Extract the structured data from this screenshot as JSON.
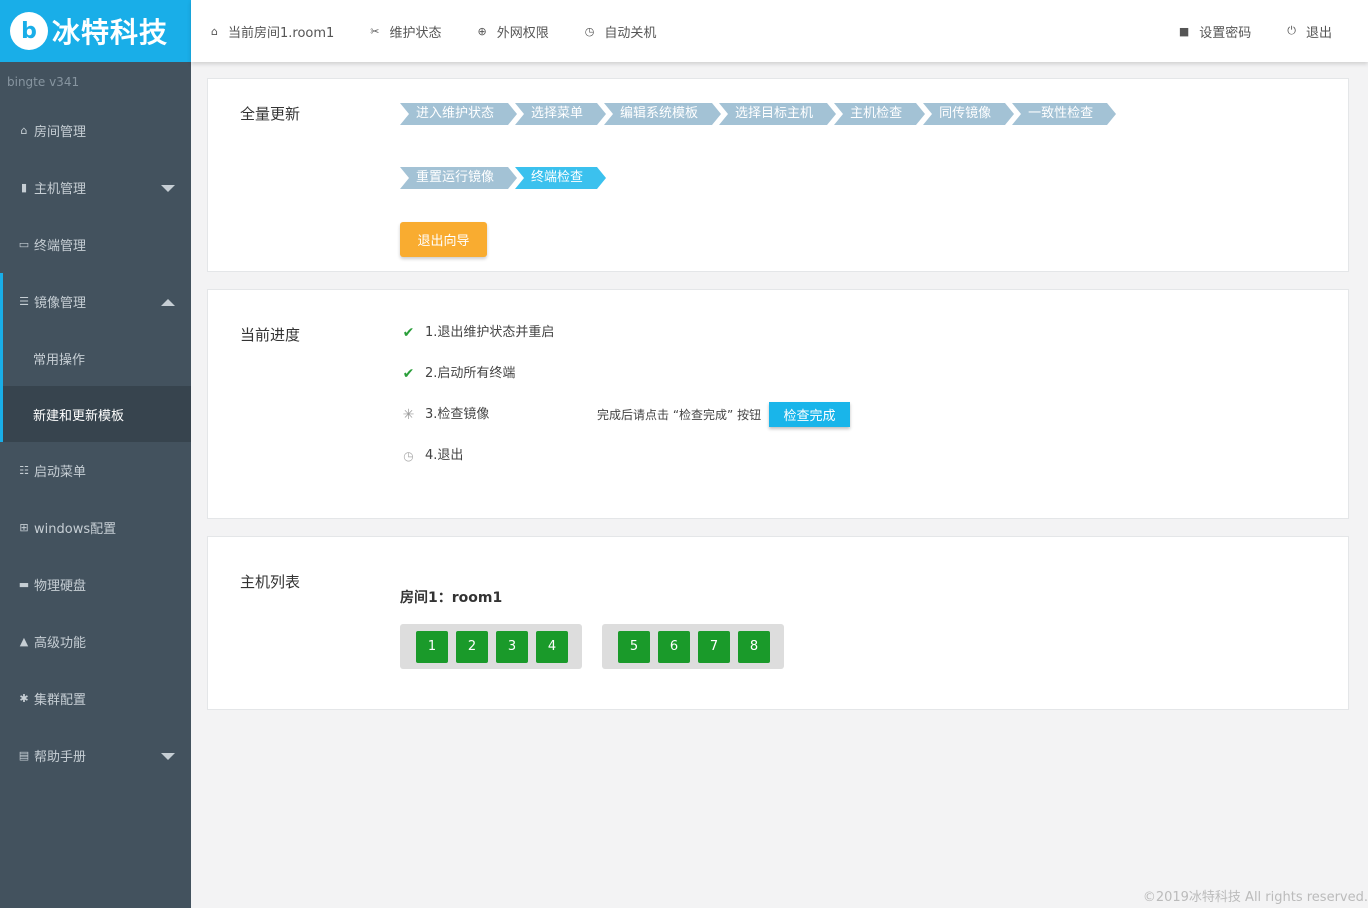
{
  "brand": {
    "logo_letter": "b",
    "name": "冰特科技",
    "version": "bingte  v341"
  },
  "sidebar": {
    "items": [
      {
        "label": "房间管理",
        "icon": "home-icon"
      },
      {
        "label": "主机管理",
        "icon": "server-icon",
        "caret": "down"
      },
      {
        "label": "终端管理",
        "icon": "monitor-icon"
      },
      {
        "label": "镜像管理",
        "icon": "database-icon",
        "caret": "up",
        "open": true
      },
      {
        "label": "启动菜单",
        "icon": "list-icon"
      },
      {
        "label": "windows配置",
        "icon": "windows-icon"
      },
      {
        "label": "物理硬盘",
        "icon": "hdd-icon"
      },
      {
        "label": "高级功能",
        "icon": "warning-icon"
      },
      {
        "label": "集群配置",
        "icon": "gear-icon"
      },
      {
        "label": "帮助手册",
        "icon": "book-icon",
        "caret": "down"
      }
    ],
    "submenu": [
      {
        "label": "常用操作"
      },
      {
        "label": "新建和更新模板",
        "active": true
      }
    ]
  },
  "topbar": {
    "left": [
      {
        "label": "当前房间1.room1",
        "icon": "home-icon"
      },
      {
        "label": "维护状态",
        "icon": "tools-icon"
      },
      {
        "label": "外网权限",
        "icon": "globe-icon"
      },
      {
        "label": "自动关机",
        "icon": "clock-icon"
      }
    ],
    "right": [
      {
        "label": "设置密码",
        "icon": "lock-icon"
      },
      {
        "label": "退出",
        "icon": "power-icon"
      }
    ]
  },
  "full_update": {
    "title": "全量更新",
    "steps_row1": [
      "进入维护状态",
      "选择菜单",
      "编辑系统模板",
      "选择目标主机",
      "主机检查",
      "同传镜像",
      "一致性检查"
    ],
    "steps_row2": [
      "重置运行镜像",
      "终端检查"
    ],
    "current_step": "终端检查",
    "exit_button": "退出向导"
  },
  "progress": {
    "title": "当前进度",
    "items": [
      {
        "label": "1.退出维护状态并重启",
        "status": "done"
      },
      {
        "label": "2.启动所有终端",
        "status": "done"
      },
      {
        "label": "3.检查镜像",
        "status": "running"
      },
      {
        "label": "4.退出",
        "status": "pending"
      }
    ],
    "hint": "完成后请点击 “检查完成” 按钮",
    "done_button": "检查完成"
  },
  "hosts": {
    "title": "主机列表",
    "room_title": "房间1：room1",
    "groups": [
      [
        "1",
        "2",
        "3",
        "4"
      ],
      [
        "5",
        "6",
        "7",
        "8"
      ]
    ],
    "host_color": "#1a9a2a"
  },
  "footer": "©2019冰特科技 All rights reserved.",
  "colors": {
    "accent": "#19aee8",
    "step": "#a3c2d5",
    "step_current": "#3bc1ee",
    "warning_button": "#f9ac30",
    "sidebar_bg": "#43525e"
  }
}
